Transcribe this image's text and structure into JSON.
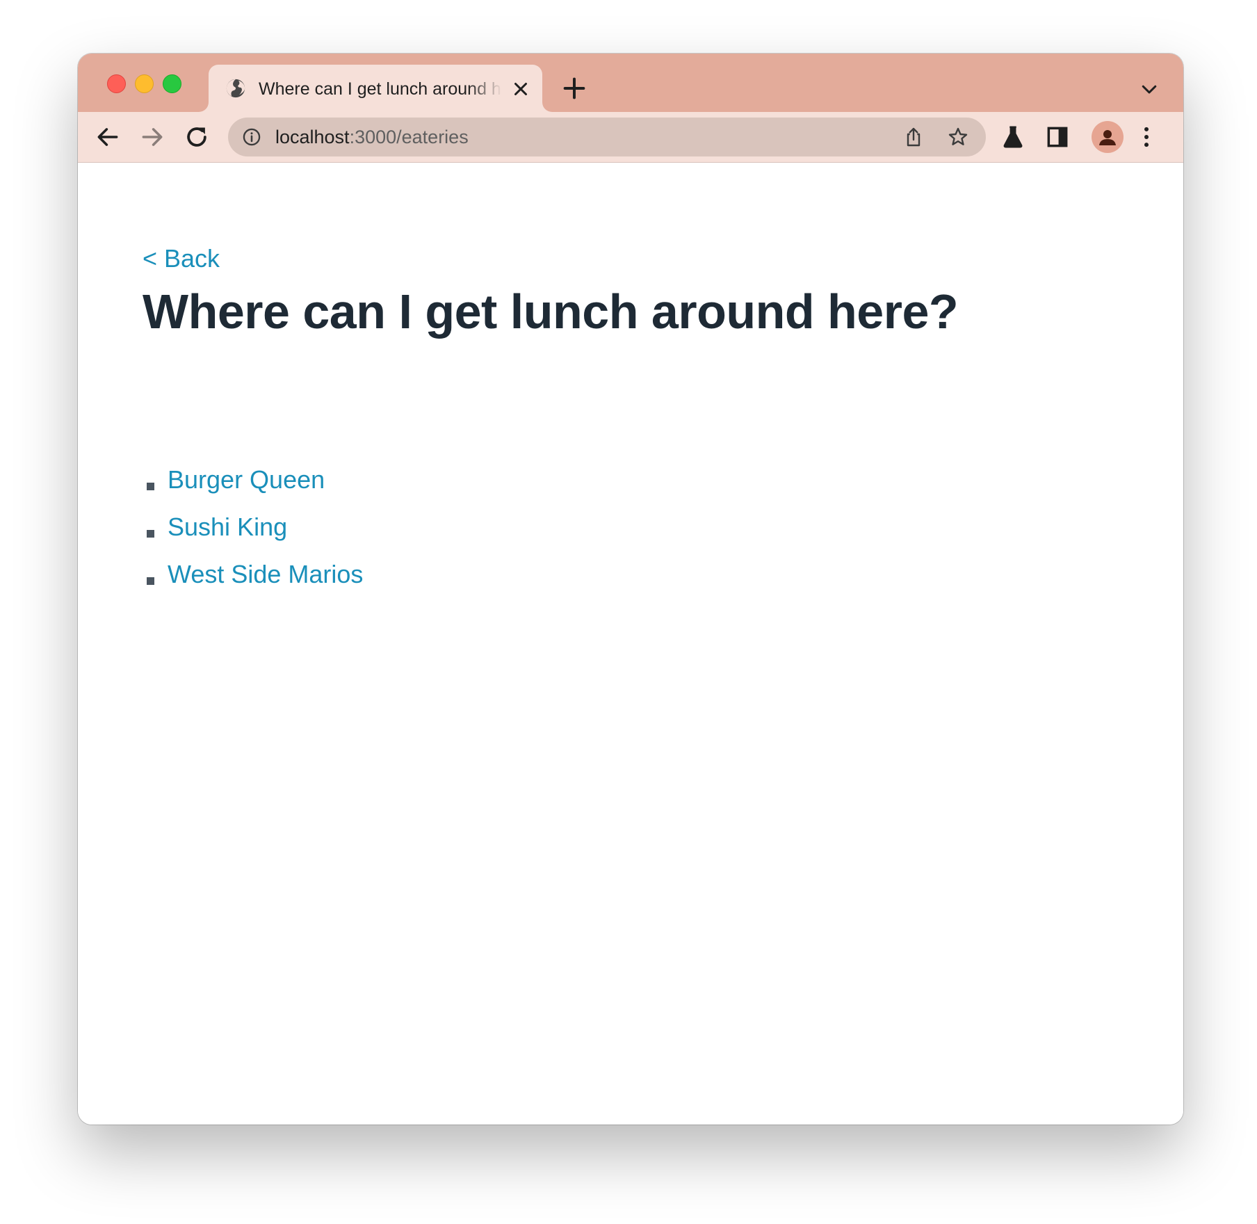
{
  "browser": {
    "tab": {
      "title": "Where can I get lunch around here?",
      "favicon": "globe-icon"
    },
    "address_bar": {
      "host": "localhost",
      "path": ":3000/eateries"
    },
    "icons": {
      "back": "arrow-left-icon",
      "forward": "arrow-right-icon",
      "reload": "reload-icon",
      "site_info": "info-icon",
      "share": "share-icon",
      "bookmark": "star-icon",
      "labs": "flask-icon",
      "side_panel": "side-panel-icon",
      "profile": "avatar-icon",
      "menu": "kebab-menu-icon",
      "new_tab": "plus-icon",
      "tab_list": "chevron-down-icon",
      "close_tab": "close-icon"
    },
    "colors": {
      "titlebar": "#e3ab9a",
      "toolbar": "#f6e0d9",
      "omnibox": "#d9c4bc",
      "link": "#1a8fba",
      "heading": "#1e2a35"
    }
  },
  "page": {
    "back_link": "< Back",
    "title": "Where can I get lunch around here?",
    "eateries": [
      {
        "name": "Burger Queen"
      },
      {
        "name": "Sushi King"
      },
      {
        "name": "West Side Marios"
      }
    ]
  }
}
